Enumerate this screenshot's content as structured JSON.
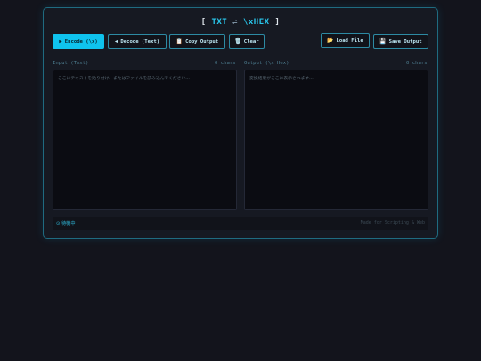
{
  "title": {
    "open": "[ ",
    "left": "TXT",
    "sep": " ⇌ ",
    "right": "\\xHEX",
    "close": " ]"
  },
  "toolbar": {
    "encode": {
      "icon": "▶",
      "label": "Encode (\\x)"
    },
    "decode": {
      "icon": "◀",
      "label": "Decode (Text)"
    },
    "copy": {
      "icon": "📋",
      "label": "Copy Output"
    },
    "clear": {
      "icon": "🗑",
      "label": "Clear"
    },
    "load": {
      "icon": "📂",
      "label": "Load File"
    },
    "save": {
      "icon": "💾",
      "label": "Save Output"
    }
  },
  "input": {
    "label": "Input (Text)",
    "count": "0 chars",
    "placeholder": "ここにテキストを貼り付け、またはファイルを読み込んでください..."
  },
  "output": {
    "label": "Output (\\x Hex)",
    "count": "0 chars",
    "placeholder": "変換結果がここに表示されます..."
  },
  "status": {
    "text": "⊙ 待機中",
    "made": "Made for Scripting & Web"
  },
  "colors": {
    "accent": "#0fc3ee",
    "border": "#1f6b80",
    "background": "#13141c"
  }
}
